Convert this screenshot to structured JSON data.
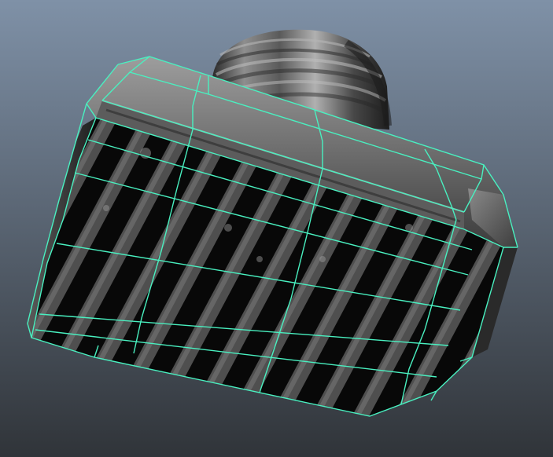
{
  "viewport": {
    "bg_top": "#7f91a7",
    "bg_bottom": "#303439",
    "wire_color": "#49f0c0",
    "model_dark": "#0b0b0b",
    "model_mid": "#4c4c4c",
    "model_light": "#a8a8a8",
    "subject": "vent-grille-icon"
  }
}
